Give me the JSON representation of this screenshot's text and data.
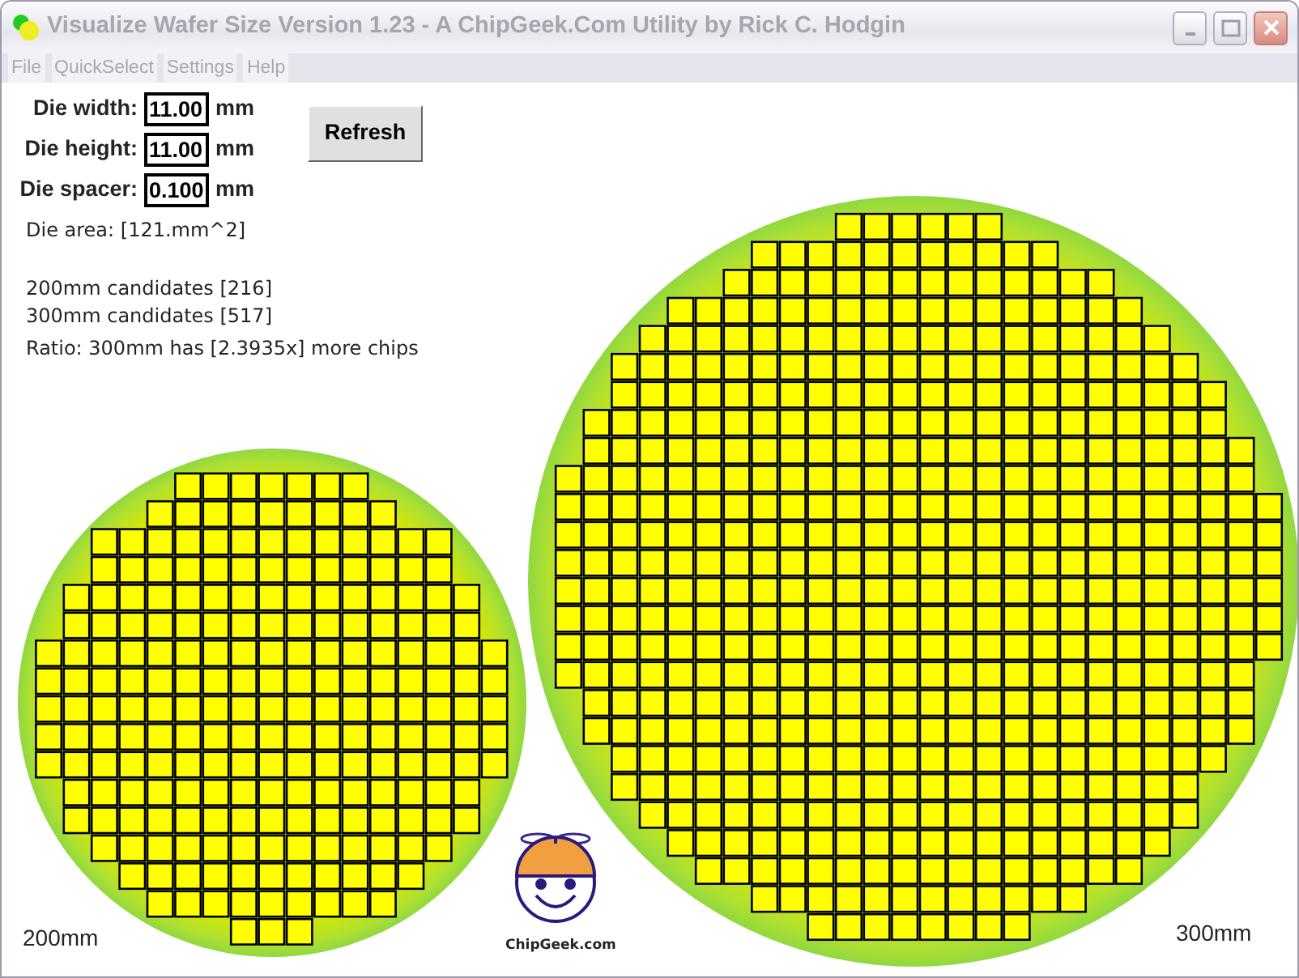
{
  "window": {
    "title": "Visualize Wafer Size Version 1.23 - A ChipGeek.Com Utility by Rick C. Hodgin"
  },
  "menu": [
    "File",
    "QuickSelect",
    "Settings",
    "Help"
  ],
  "fields": [
    {
      "label": "Die width:",
      "value": "11.00",
      "unit": "mm"
    },
    {
      "label": "Die height:",
      "value": "11.00",
      "unit": "mm"
    },
    {
      "label": "Die spacer:",
      "value": "0.100",
      "unit": "mm"
    }
  ],
  "refresh_button": "Refresh",
  "die_area": "Die area: [121.mm^2]",
  "results": [
    "200mm candidates [216]",
    "300mm candidates [517]",
    "Ratio: 300mm has [2.3935x] more chips"
  ],
  "wafers": [
    {
      "label": "200mm"
    },
    {
      "label": "300mm"
    }
  ],
  "logo_text": "ChipGeek.com"
}
